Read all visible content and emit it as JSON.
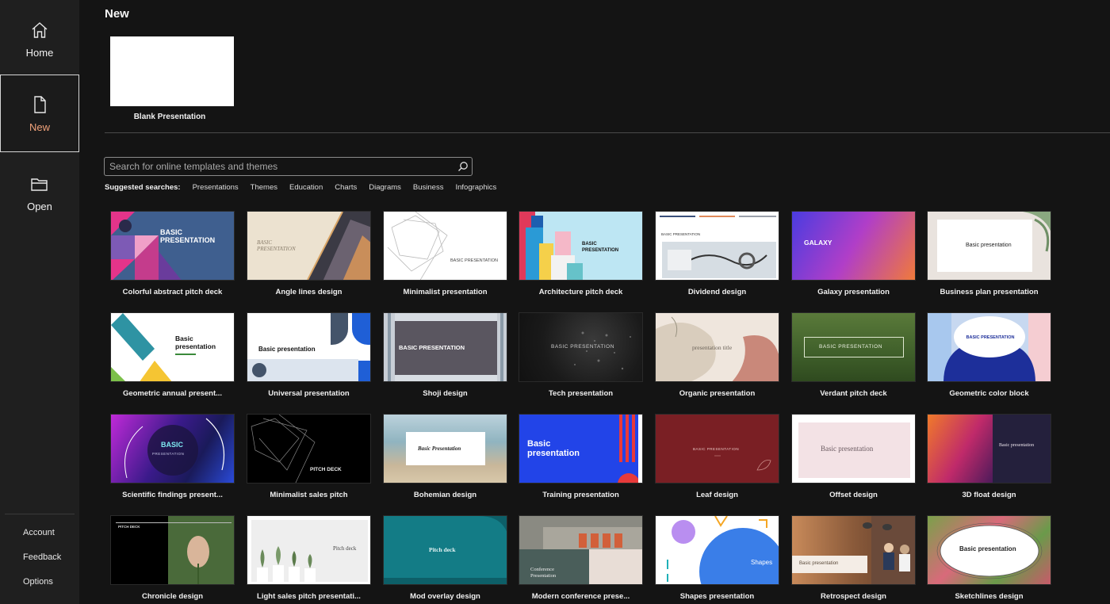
{
  "sidebar": {
    "home_label": "Home",
    "new_label": "New",
    "open_label": "Open",
    "account_label": "Account",
    "feedback_label": "Feedback",
    "options_label": "Options"
  },
  "page": {
    "title": "New",
    "blank_label": "Blank Presentation"
  },
  "search": {
    "placeholder": "Search for online templates and themes",
    "suggested_label": "Suggested searches:",
    "suggestions": [
      "Presentations",
      "Themes",
      "Education",
      "Charts",
      "Diagrams",
      "Business",
      "Infographics"
    ]
  },
  "templates": {
    "colorful": {
      "label": "Colorful abstract pitch deck",
      "thumb": "BASIC PRESENTATION"
    },
    "angle": {
      "label": "Angle lines design",
      "thumb": "BASIC PRESENTATION"
    },
    "minimalist": {
      "label": "Minimalist presentation",
      "thumb": "BASIC PRESENTATION"
    },
    "architecture": {
      "label": "Architecture pitch deck",
      "thumb": "BASIC PRESENTATION"
    },
    "dividend": {
      "label": "Dividend design",
      "thumb": "BASIC PRESENTATION"
    },
    "galaxy": {
      "label": "Galaxy presentation",
      "thumb": "GALAXY"
    },
    "business": {
      "label": "Business plan presentation",
      "thumb": "Basic presentation"
    },
    "geometric": {
      "label": "Geometric annual present...",
      "thumb": "Basic presentation"
    },
    "universal": {
      "label": "Universal presentation",
      "thumb": "Basic presentation"
    },
    "shoji": {
      "label": "Shoji design",
      "thumb": "BASIC PRESENTATION"
    },
    "tech": {
      "label": "Tech presentation",
      "thumb": "BASIC PRESENTATION"
    },
    "organic": {
      "label": "Organic presentation",
      "thumb": "presentation title"
    },
    "verdant": {
      "label": "Verdant pitch deck",
      "thumb": "BASIC PRESENTATION"
    },
    "geocolor": {
      "label": "Geometric color block",
      "thumb": "BASIC PRESENTATION"
    },
    "scientific": {
      "label": "Scientific findings present...",
      "thumb": "BASIC",
      "thumb2": "PRESENTATION"
    },
    "minsales": {
      "label": "Minimalist sales pitch",
      "thumb": "PITCH DECK"
    },
    "bohemian": {
      "label": "Bohemian design",
      "thumb": "Basic Presentation"
    },
    "training": {
      "label": "Training presentation",
      "thumb": "Basic presentation"
    },
    "leaf": {
      "label": "Leaf design",
      "thumb": "BASIC PRESENTATION"
    },
    "offset": {
      "label": "Offset design",
      "thumb": "Basic presentation"
    },
    "float3d": {
      "label": "3D float design",
      "thumb": "Basic presentation"
    },
    "chronicle": {
      "label": "Chronicle design",
      "thumb": "PITCH DECK"
    },
    "lightsales": {
      "label": "Light sales pitch presentati...",
      "thumb": "Pitch deck"
    },
    "modoverlay": {
      "label": "Mod overlay design",
      "thumb": "Pitch deck"
    },
    "modernconf": {
      "label": "Modern conference prese...",
      "thumb": "Conference Presentation"
    },
    "shapes": {
      "label": "Shapes presentation",
      "thumb": "Shapes"
    },
    "retrospect": {
      "label": "Retrospect design",
      "thumb": "Basic presentation"
    },
    "sketchlines": {
      "label": "Sketchlines design",
      "thumb": "Basic presentation"
    }
  },
  "colors": {
    "background": "#141414",
    "sidebar": "#1f1f1f",
    "active_accent": "#f0a27a"
  }
}
